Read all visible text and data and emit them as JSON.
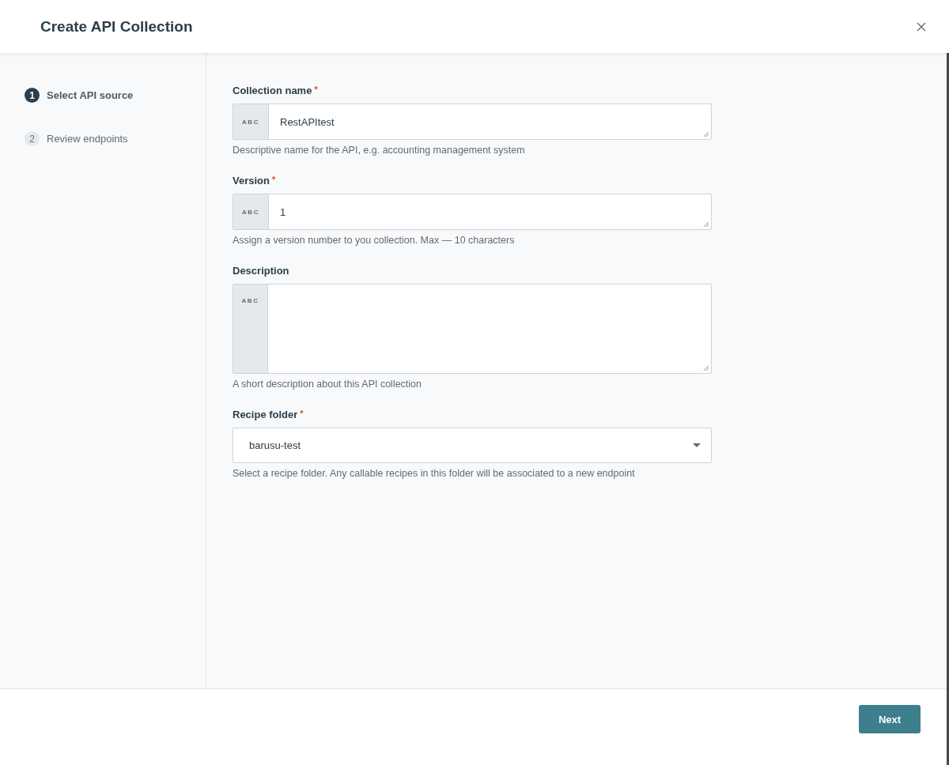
{
  "dialog": {
    "title": "Create API Collection"
  },
  "steps": [
    {
      "number": "1",
      "label": "Select API source",
      "selected": true
    },
    {
      "number": "2",
      "label": "Review endpoints",
      "selected": false
    }
  ],
  "fields": [
    {
      "kind": "text",
      "label": "Collection name",
      "required_mark": "*",
      "prefix": "ABC",
      "value": "RestAPItest",
      "help": "Descriptive name for the API, e.g. accounting management system"
    },
    {
      "kind": "text",
      "label": "Version",
      "required_mark": "*",
      "prefix": "ABC",
      "value": "1",
      "help": "Assign a version number to you collection. Max — 10 characters"
    },
    {
      "kind": "textarea",
      "label": "Description",
      "prefix": "ABC",
      "help": "A short description about this API collection"
    },
    {
      "kind": "select",
      "label": "Recipe folder",
      "required_mark": "*",
      "value": "barusu-test",
      "help": "Select a recipe folder. Any callable recipes in this folder will be associated to a new endpoint"
    }
  ],
  "footer": {
    "next_button": "Next"
  }
}
